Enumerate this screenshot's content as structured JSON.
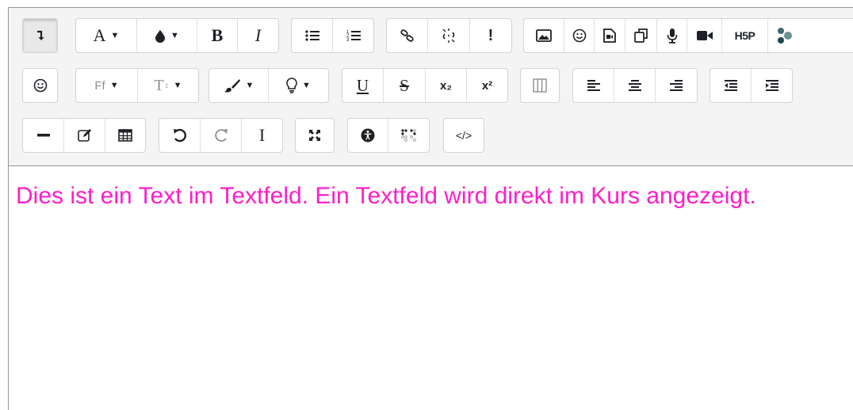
{
  "toolbar": {
    "row1": {
      "font_color_glyph": "A",
      "bold_glyph": "B",
      "italic_glyph": "I",
      "important_glyph": "!",
      "h5p_glyph": "H5P"
    },
    "row2": {
      "font_family_glyph": "Ff",
      "font_size_glyph": "T",
      "underline_glyph": "U",
      "strike_glyph": "S",
      "subscript_glyph": "x₂",
      "superscript_glyph": "x²"
    },
    "row3": {
      "clear_format_glyph": "I",
      "html_glyph": "</>"
    }
  },
  "editor": {
    "text": "Dies ist ein Text im Textfeld. Ein Textfeld wird direkt im Kurs angezeigt.",
    "text_color": "#ff1ec8"
  },
  "icons": [
    "collapse-icon",
    "font-color-icon",
    "background-color-icon",
    "bold-icon",
    "italic-icon",
    "unordered-list-icon",
    "ordered-list-icon",
    "link-icon",
    "unlink-icon",
    "important-icon",
    "image-icon",
    "emoji-icon",
    "media-icon",
    "manage-files-icon",
    "record-audio-icon",
    "record-video-icon",
    "h5p-icon",
    "wiris-icon",
    "emoji-picker-icon",
    "font-family-icon",
    "font-size-icon",
    "brush-icon",
    "hint-icon",
    "underline-icon",
    "strikethrough-icon",
    "subscript-icon",
    "superscript-icon",
    "columns-icon",
    "align-left-icon",
    "align-center-icon",
    "align-right-icon",
    "outdent-icon",
    "indent-icon",
    "horizontal-rule-icon",
    "edit-icon",
    "table-icon",
    "undo-icon",
    "redo-icon",
    "clear-formatting-icon",
    "fullscreen-icon",
    "accessibility-checker-icon",
    "screenreader-helper-icon",
    "html-icon"
  ]
}
